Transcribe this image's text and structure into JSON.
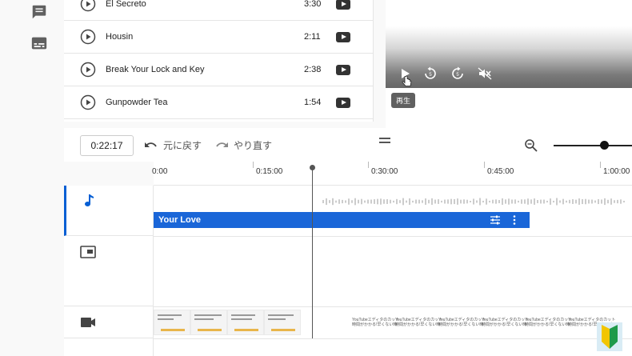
{
  "rail": {
    "icons": [
      "comment-icon",
      "subtitles-icon"
    ]
  },
  "audio_library": {
    "tracks": [
      {
        "title": "El Secreto",
        "duration": "3:30"
      },
      {
        "title": "Housin",
        "duration": "2:11"
      },
      {
        "title": "Break Your Lock and Key",
        "duration": "2:38"
      },
      {
        "title": "Gunpowder Tea",
        "duration": "1:54"
      }
    ]
  },
  "preview": {
    "tooltip": "再生"
  },
  "toolbar": {
    "timecode": "0:22:17",
    "undo_label": "元に戻す",
    "redo_label": "やり直す"
  },
  "ruler": {
    "ticks": [
      "0:00",
      "0:15:00",
      "0:30:00",
      "0:45:00",
      "1:00:00"
    ]
  },
  "tracks": {
    "audio_clip_title": "Your Love"
  },
  "thumb_caption": "YouTubeエディタのカット\n時間がかかる!早くない時"
}
